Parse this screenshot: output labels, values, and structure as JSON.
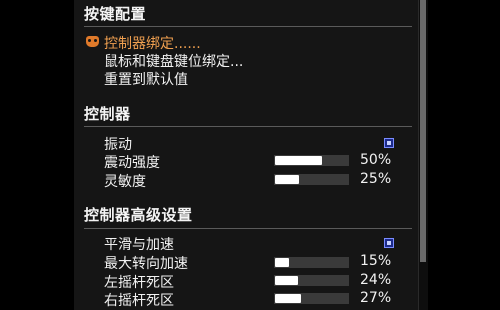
{
  "sections": {
    "key_config": {
      "title": "按键配置",
      "items": {
        "controller_binding": "控制器绑定......",
        "mouse_keyboard_binding": "鼠标和键盘键位绑定...",
        "reset_defaults": "重置到默认值"
      }
    },
    "controller": {
      "title": "控制器",
      "vibration": {
        "label": "振动",
        "checked": true
      },
      "vibration_strength": {
        "label": "震动强度",
        "value": 0.5,
        "display": "50%"
      },
      "sensitivity": {
        "label": "灵敏度",
        "value": 0.25,
        "display": "25%"
      }
    },
    "controller_advanced": {
      "title": "控制器高级设置",
      "smoothing": {
        "label": "平滑与加速",
        "checked": true
      },
      "max_turn_accel": {
        "label": "最大转向加速",
        "value": 0.15,
        "display": "15%"
      },
      "left_stick_deadzone": {
        "label": "左摇杆死区",
        "value": 0.24,
        "display": "24%"
      },
      "right_stick_deadzone": {
        "label": "右摇杆死区",
        "value": 0.27,
        "display": "27%"
      }
    }
  },
  "colors": {
    "panel_bg": "#151515",
    "selected_text": "#f0a050",
    "checkbox_fill": "#1c2a8a",
    "slider_fill": "#ffffff",
    "slider_track": "#3a3a3a"
  },
  "icons": {
    "selected_item_icon": "gamepad-icon"
  }
}
